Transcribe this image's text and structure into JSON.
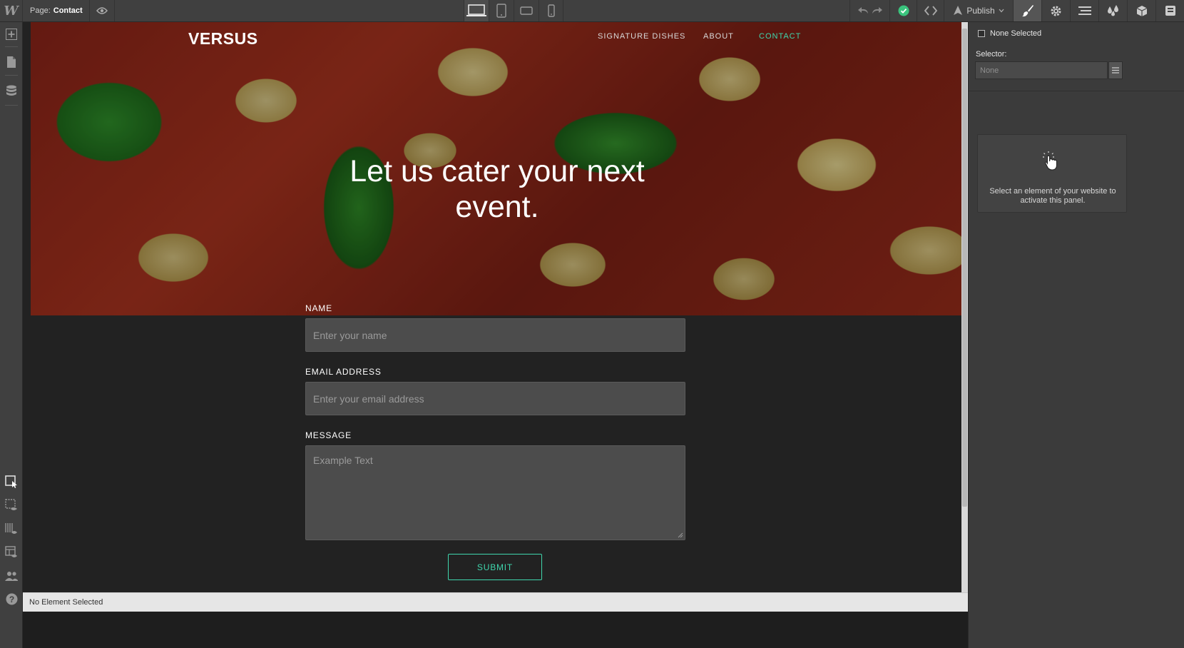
{
  "editor": {
    "logo": "W",
    "page_label": "Page:",
    "page_name": "Contact",
    "publish_label": "Publish",
    "status_text": "No Element Selected"
  },
  "icons": {
    "preview": "eye-icon",
    "devices": [
      "desktop-icon",
      "tablet-icon",
      "mobile-landscape-icon",
      "mobile-portrait-icon"
    ],
    "right_tabs": [
      "brush-icon",
      "gear-icon",
      "navigator-icon",
      "swatches-icon",
      "box-icon",
      "settings-panel-icon"
    ],
    "left_tools": [
      "add-icon",
      "pages-icon",
      "cms-icon",
      "select-icon",
      "element-visibility-icon",
      "grid-icon",
      "preview-layout-icon",
      "collaborators-icon",
      "help-icon"
    ]
  },
  "site": {
    "brand": "VERSUS",
    "nav": [
      "SIGNATURE DISHES",
      "ABOUT",
      "CONTACT"
    ],
    "hero_title": "Let us cater your next event.",
    "form": {
      "name_label": "NAME",
      "name_placeholder": "Enter your name",
      "email_label": "EMAIL ADDRESS",
      "email_placeholder": "Enter your email address",
      "message_label": "MESSAGE",
      "message_placeholder": "Example Text",
      "submit_label": "SUBMIT"
    }
  },
  "panel": {
    "none_selected": "None Selected",
    "selector_label": "Selector:",
    "selector_placeholder": "None",
    "hint": "Select an element of your website to activate this panel."
  },
  "colors": {
    "accent": "#3fd6ad",
    "publish_check": "#3ac47d"
  }
}
